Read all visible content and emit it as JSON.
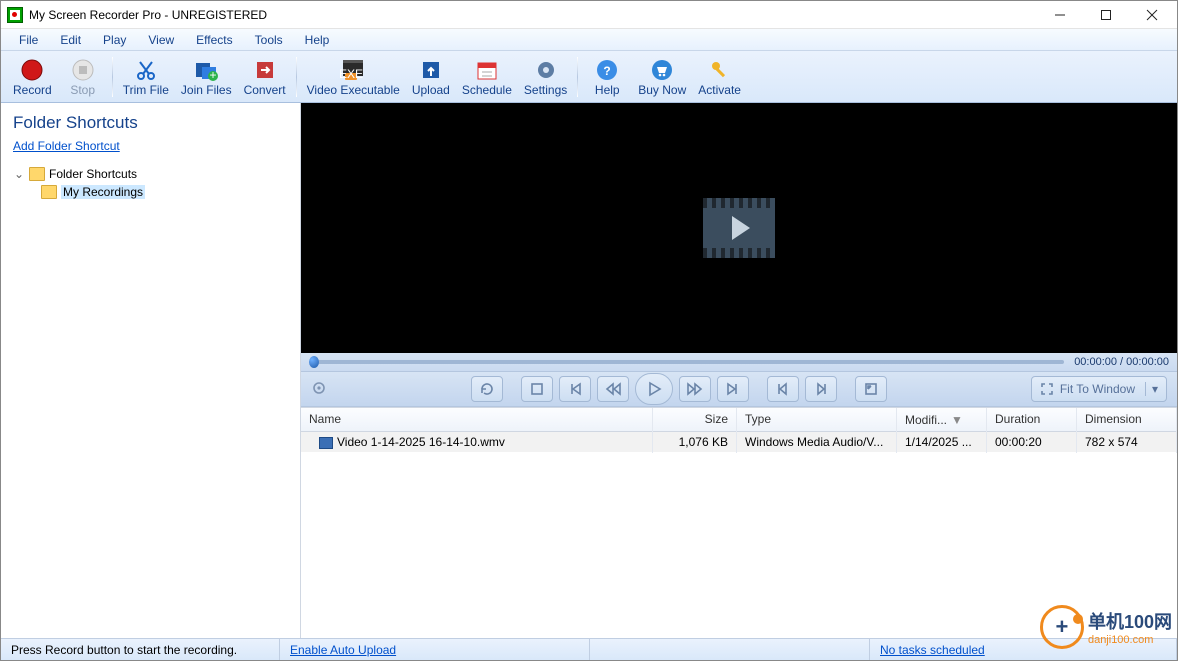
{
  "window": {
    "title": "My Screen Recorder Pro - UNREGISTERED"
  },
  "menu": {
    "items": [
      "File",
      "Edit",
      "Play",
      "View",
      "Effects",
      "Tools",
      "Help"
    ]
  },
  "toolbar": {
    "record": "Record",
    "stop": "Stop",
    "trim": "Trim File",
    "join": "Join Files",
    "convert": "Convert",
    "exe": "Video Executable",
    "upload": "Upload",
    "schedule": "Schedule",
    "settings": "Settings",
    "help": "Help",
    "buy": "Buy Now",
    "activate": "Activate"
  },
  "sidebar": {
    "title": "Folder Shortcuts",
    "add_link": "Add Folder Shortcut",
    "root": "Folder Shortcuts",
    "child": "My Recordings"
  },
  "player": {
    "time": "00:00:00 / 00:00:00",
    "fit": "Fit To Window"
  },
  "filelist": {
    "headers": {
      "name": "Name",
      "size": "Size",
      "type": "Type",
      "modified": "Modifi...",
      "duration": "Duration",
      "dimension": "Dimension"
    },
    "row": {
      "name": "Video 1-14-2025 16-14-10.wmv",
      "size": "1,076 KB",
      "type": "Windows Media Audio/V...",
      "modified": "1/14/2025 ...",
      "duration": "00:00:20",
      "dimension": "782 x 574"
    }
  },
  "status": {
    "hint": "Press Record button to start the recording.",
    "auto": "Enable Auto Upload",
    "tasks": "No tasks scheduled"
  },
  "watermark": {
    "brand": "单机100网",
    "url": "danji100.com"
  }
}
